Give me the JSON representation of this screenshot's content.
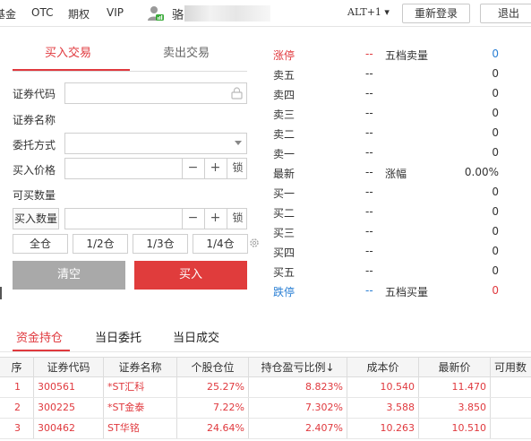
{
  "topbar": {
    "nav": [
      "基金",
      "OTC",
      "期权",
      "VIP"
    ],
    "username": "骆",
    "shortcut": "ALT+1",
    "relogin": "重新登录",
    "logout": "退出"
  },
  "trade_tabs": {
    "buy": "买入交易",
    "sell": "卖出交易"
  },
  "form": {
    "code_label": "证券代码",
    "name_label": "证券名称",
    "order_type_label": "委托方式",
    "price_label": "买入价格",
    "available_label": "可买数量",
    "qty_button": "买入数量",
    "minus": "−",
    "plus": "+",
    "lock": "锁",
    "positions": [
      "全仓",
      "1/2仓",
      "1/3仓",
      "1/4仓"
    ],
    "clear": "清空",
    "buy": "买入"
  },
  "quote": {
    "limit_up": {
      "label": "涨停",
      "value": "--",
      "mid": "五档卖量",
      "right": "0"
    },
    "asks": [
      {
        "label": "卖五",
        "value": "--",
        "qty": "0"
      },
      {
        "label": "卖四",
        "value": "--",
        "qty": "0"
      },
      {
        "label": "卖三",
        "value": "--",
        "qty": "0"
      },
      {
        "label": "卖二",
        "value": "--",
        "qty": "0"
      },
      {
        "label": "卖一",
        "value": "--",
        "qty": "0"
      }
    ],
    "last": {
      "label": "最新",
      "value": "--",
      "mid": "涨幅",
      "right": "0.00%"
    },
    "bids": [
      {
        "label": "买一",
        "value": "--",
        "qty": "0"
      },
      {
        "label": "买二",
        "value": "--",
        "qty": "0"
      },
      {
        "label": "买三",
        "value": "--",
        "qty": "0"
      },
      {
        "label": "买四",
        "value": "--",
        "qty": "0"
      },
      {
        "label": "买五",
        "value": "--",
        "qty": "0"
      }
    ],
    "limit_down": {
      "label": "跌停",
      "value": "--",
      "mid": "五档买量",
      "right": "0"
    }
  },
  "bottom_tabs": [
    "资金持仓",
    "当日委托",
    "当日成交"
  ],
  "table": {
    "headers": [
      "序",
      "证券代码",
      "证券名称",
      "个股仓位",
      "持仓盈亏比例↓",
      "成本价",
      "最新价",
      "可用数"
    ],
    "rows": [
      [
        "1",
        "300561",
        "*ST汇科",
        "25.27%",
        "8.823%",
        "10.540",
        "11.470"
      ],
      [
        "2",
        "300225",
        "*ST金泰",
        "7.22%",
        "7.302%",
        "3.588",
        "3.850"
      ],
      [
        "3",
        "300462",
        "ST华铭",
        "24.64%",
        "2.407%",
        "10.263",
        "10.510"
      ]
    ]
  },
  "colors": {
    "accent": "#e0393e",
    "fall": "#2a7fd4",
    "clear_btn": "#a9a9a9"
  }
}
